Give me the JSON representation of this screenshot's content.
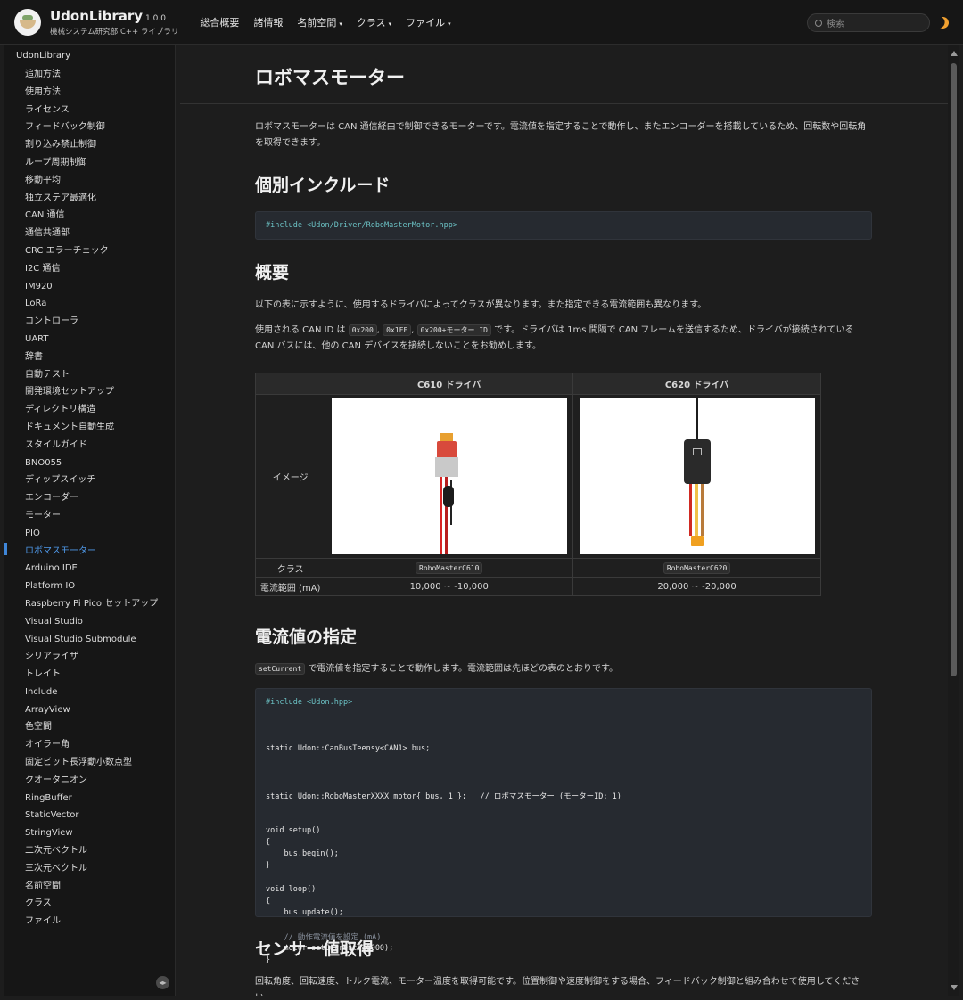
{
  "header": {
    "brand_title": "UdonLibrary",
    "brand_version": "1.0.0",
    "brand_subtitle": "機械システム研究部 C++ ライブラリ",
    "nav": [
      "総合概要",
      "諸情報",
      "名前空間",
      "クラス",
      "ファイル"
    ],
    "search_placeholder": "検索"
  },
  "sidebar": {
    "root": "UdonLibrary",
    "items": [
      "追加方法",
      "使用方法",
      "ライセンス",
      "フィードバック制御",
      "割り込み禁止制御",
      "ループ周期制御",
      "移動平均",
      "独立ステア最適化",
      "CAN 通信",
      "通信共通部",
      "CRC エラーチェック",
      "I2C 通信",
      "IM920",
      "LoRa",
      "コントローラ",
      "UART",
      "辞書",
      "自動テスト",
      "開発環境セットアップ",
      "ディレクトリ構造",
      "ドキュメント自動生成",
      "スタイルガイド",
      "BNO055",
      "ディップスイッチ",
      "エンコーダー",
      "モーター",
      "PIO",
      "ロボマスモーター",
      "Arduino IDE",
      "Platform IO",
      "Raspberry Pi Pico セットアップ",
      "Visual Studio",
      "Visual Studio Submodule",
      "シリアライザ",
      "トレイト",
      "Include",
      "ArrayView",
      "色空間",
      "オイラー角",
      "固定ビット長浮動小数点型",
      "クオータニオン",
      "RingBuffer",
      "StaticVector",
      "StringView",
      "二次元ベクトル",
      "三次元ベクトル",
      "名前空間",
      "クラス",
      "ファイル"
    ],
    "active_index": 27,
    "toggle_label": "◂▸"
  },
  "main": {
    "title": "ロボマスモーター",
    "intro": "ロボマスモーターは CAN 通信経由で制御できるモーターです。電流値を指定することで動作し、またエンコーダーを搭載しているため、回転数や回転角を取得できます。",
    "h_include": "個別インクルード",
    "include_code": "#include <Udon/Driver/RoboMasterMotor.hpp>",
    "h_overview": "概要",
    "overview_p1": "以下の表に示すように、使用するドライバによってクラスが異なります。また指定できる電流範囲も異なります。",
    "overview_p2_a": "使用される CAN ID は",
    "overview_p2_ids": [
      "0x200",
      "0x1FF",
      "0x200+モーター ID"
    ],
    "overview_p2_b": "です。ドライバは 1ms 間隔で CAN フレームを送信するため、ドライバが接続されている CAN バスには、他の CAN デバイスを接続しないことをお勧めします。",
    "table": {
      "headers": [
        "",
        "C610 ドライバ",
        "C620 ドライバ"
      ],
      "image_label": "イメージ",
      "class_label": "クラス",
      "range_label": "電流範囲 (mA)",
      "classes": [
        "RoboMasterC610",
        "RoboMasterC620"
      ],
      "ranges": [
        "10,000 ~ -10,000",
        "20,000 ~ -20,000"
      ]
    },
    "h_current": "電流値の指定",
    "current_code_inline": "setCurrent",
    "current_text": "で電流値を指定することで動作します。電流範囲は先ほどの表のとおりです。",
    "code_lines": [
      "#include <Udon.hpp>",
      "",
      "static Udon::CanBusTeensy<CAN1> bus;",
      "",
      "static Udon::RoboMasterXXXX motor{ bus, 1 };   // ロボマスモーター (モーターID: 1)",
      "",
      "void setup()",
      "{",
      "    bus.begin();",
      "}",
      "",
      "void loop()",
      "{",
      "    bus.update();",
      "",
      "    // 動作電流値を設定 (mA)",
      "    motor.setCurrent(10000);",
      "}"
    ],
    "h_sensor": "センサー値取得",
    "sensor_text": "回転角度、回転速度、トルク電流、モーター温度を取得可能です。位置制御や速度制御をする場合、フィードバック制御と組み合わせて使用してください。"
  }
}
